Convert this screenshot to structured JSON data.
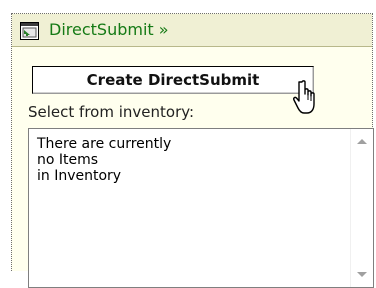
{
  "header": {
    "title": "DirectSubmit »",
    "icon": "window-form-icon",
    "title_color": "#157a15"
  },
  "create_button": {
    "label": "Create DirectSubmit"
  },
  "inventory": {
    "label": "Select from inventory:",
    "list_text": "There are currently\nno Items\nin Inventory"
  },
  "cursor": {
    "icon": "hand-pointer-icon"
  }
}
